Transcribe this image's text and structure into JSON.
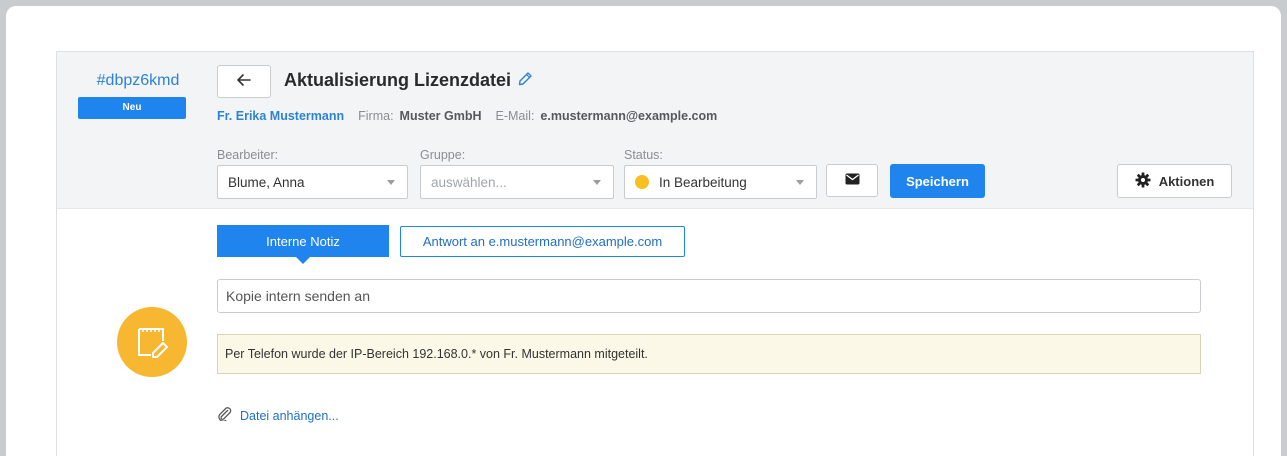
{
  "ticket": {
    "id": "#dbpz6kmd",
    "badge": "Neu",
    "title": "Aktualisierung Lizenzdatei",
    "customer_name": "Fr. Erika Mustermann",
    "company_label": "Firma:",
    "company_value": "Muster GmbH",
    "email_label": "E-Mail:",
    "email_value": "e.mustermann@example.com"
  },
  "fields": {
    "assignee_label": "Bearbeiter:",
    "assignee_value": "Blume, Anna",
    "group_label": "Gruppe:",
    "group_placeholder": "auswählen...",
    "status_label": "Status:",
    "status_value": "In Bearbeitung",
    "status_color": "#f7c020"
  },
  "toolbar": {
    "save_label": "Speichern",
    "actions_label": "Aktionen"
  },
  "compose": {
    "tab_internal": "Interne Notiz",
    "tab_reply": "Antwort an e.mustermann@example.com",
    "copy_placeholder": "Kopie intern senden an",
    "note_text": "Per Telefon wurde der IP-Bereich 192.168.0.* von Fr. Mustermann mitgeteilt.",
    "attach_label": "Datei anhängen..."
  },
  "colors": {
    "accent": "#1f84ee",
    "note_icon_bg": "#f7b731",
    "note_bg": "#fcf8e7"
  },
  "icons": {
    "back": "arrow-left-icon",
    "edit": "edit-pen-icon",
    "mail": "envelope-icon",
    "actions": "gear-icon",
    "note": "note-pencil-icon",
    "attach": "paperclip-icon"
  }
}
